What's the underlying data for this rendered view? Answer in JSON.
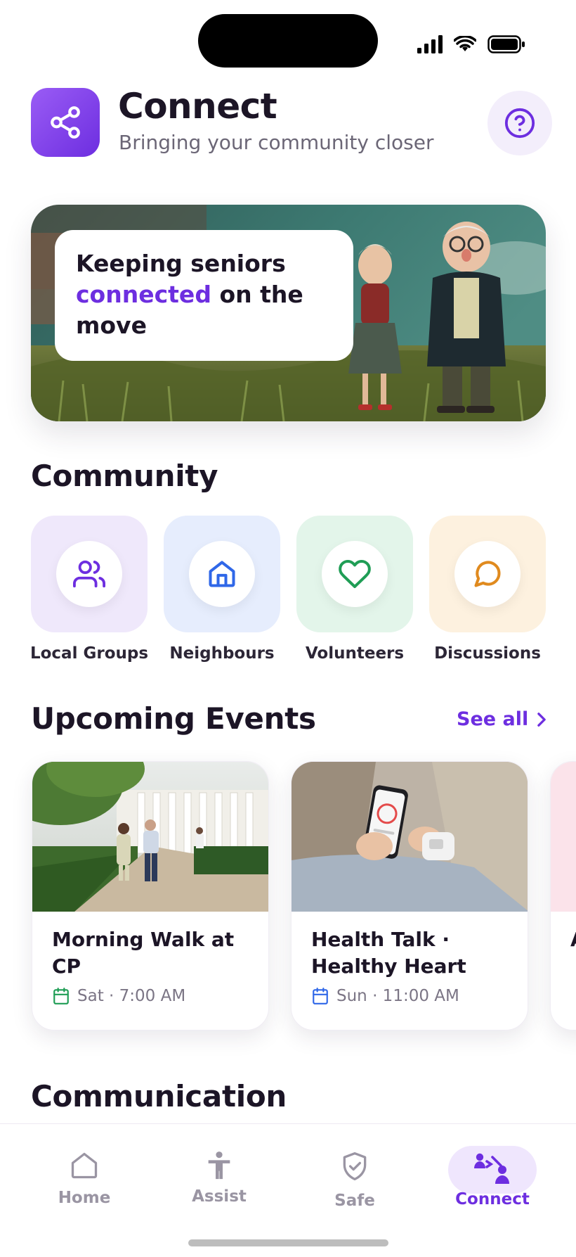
{
  "header": {
    "title": "Connect",
    "subtitle": "Bringing your community closer"
  },
  "hero": {
    "line1": "Keeping seniors",
    "accent": "connected",
    "line2_rest": " on the",
    "line3": "move"
  },
  "community": {
    "title": "Community",
    "items": [
      {
        "label": "Local Groups",
        "icon": "users-icon",
        "bg": "#efe8fb",
        "color": "#6d2ee0"
      },
      {
        "label": "Neighbours",
        "icon": "home-icon",
        "bg": "#e6edfd",
        "color": "#2f67e8"
      },
      {
        "label": "Volunteers",
        "icon": "heart-icon",
        "bg": "#e3f5ea",
        "color": "#1f9d55"
      },
      {
        "label": "Discussions",
        "icon": "chat-icon",
        "bg": "#fdf1df",
        "color": "#e08a1e"
      }
    ]
  },
  "events": {
    "title": "Upcoming Events",
    "see_all": "See all",
    "items": [
      {
        "title": "Morning Walk at CP",
        "meta": "Sat · 7:00 AM",
        "icon_color": "#1f9d55"
      },
      {
        "title": "Health Talk · Healthy Heart",
        "meta": "Sun · 11:00 AM",
        "icon_color": "#2f67e8"
      },
      {
        "title": "A W",
        "meta": "",
        "icon_color": "#e0567a"
      }
    ]
  },
  "communication": {
    "title": "Communication"
  },
  "nav": {
    "items": [
      {
        "label": "Home",
        "icon": "home-icon"
      },
      {
        "label": "Assist",
        "icon": "accessibility-icon"
      },
      {
        "label": "Safe",
        "icon": "shield-icon"
      },
      {
        "label": "Connect",
        "icon": "connect-icon",
        "active": true
      }
    ],
    "active_color": "#6d2ee0"
  }
}
